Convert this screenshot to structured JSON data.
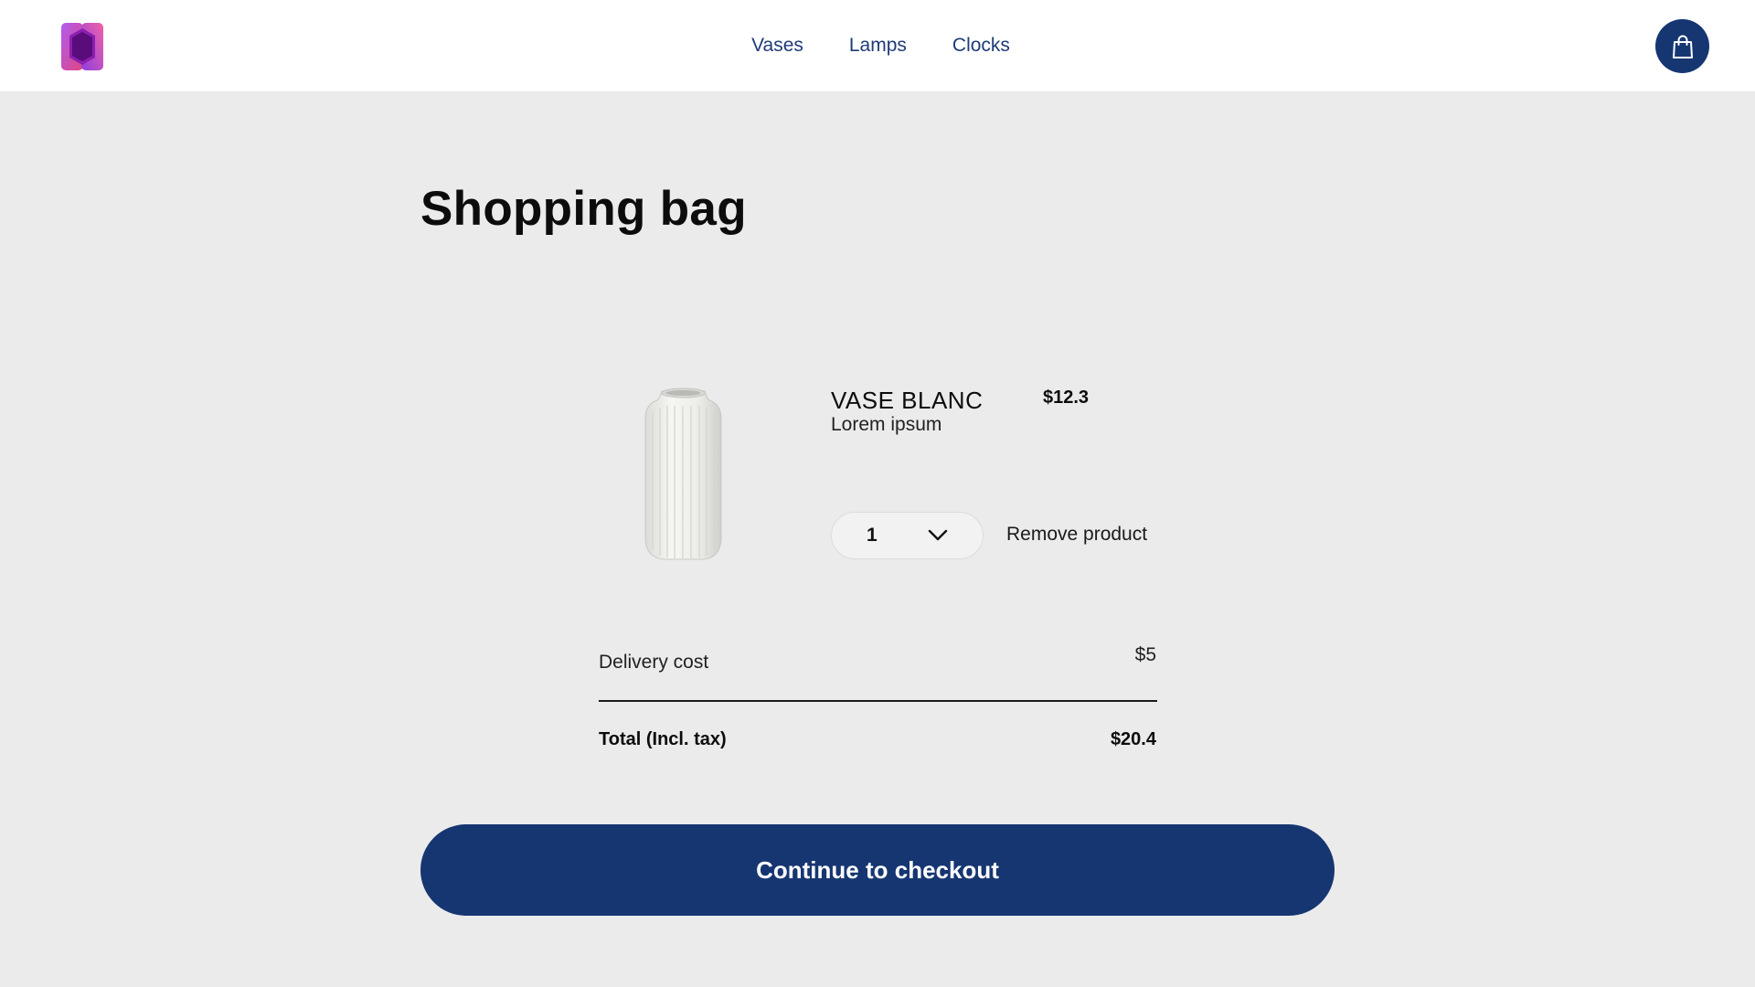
{
  "header": {
    "logo_icon": "hexagon-logo-icon",
    "nav": [
      {
        "label": "Vases"
      },
      {
        "label": "Lamps"
      },
      {
        "label": "Clocks"
      }
    ],
    "cart_icon": "shopping-bag-icon"
  },
  "main": {
    "title": "Shopping bag",
    "cart_items": [
      {
        "name": "VASE BLANC",
        "description": "Lorem ipsum",
        "price": "$12.3",
        "quantity": "1",
        "quantity_icon": "chevron-down-icon",
        "remove_label": "Remove product",
        "image": "white-ribbed-vase-image"
      }
    ],
    "summary": {
      "delivery_label": "Delivery cost",
      "delivery_value": "$5",
      "total_label": "Total (Incl. tax)",
      "total_value": "$20.4"
    },
    "checkout_label": "Continue to checkout"
  },
  "colors": {
    "primary": "#163672",
    "nav_text": "#1f3b78",
    "page_background": "#ebebeb",
    "header_background": "#ffffff"
  }
}
